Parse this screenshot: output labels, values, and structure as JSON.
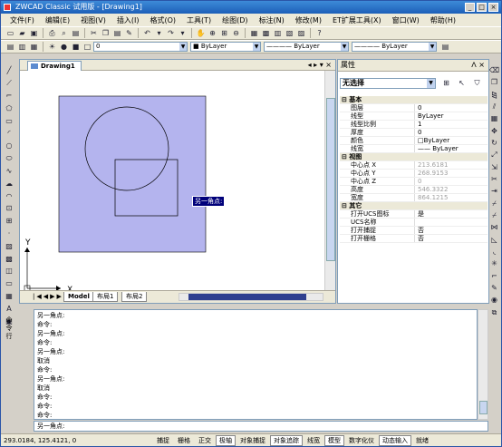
{
  "title": "ZWCAD Classic 试用版 - [Drawing1]",
  "window_buttons": [
    "_",
    "□",
    "×"
  ],
  "menu": [
    "文件(F)",
    "编辑(E)",
    "视图(V)",
    "插入(I)",
    "格式(O)",
    "工具(T)",
    "绘图(D)",
    "标注(N)",
    "修改(M)",
    "ET扩展工具(X)",
    "窗口(W)",
    "帮助(H)"
  ],
  "toolbar2": {
    "layer_value": "0",
    "color_value": "ByLayer",
    "linetype_value": "ByLayer",
    "lineweight_value": "ByLayer"
  },
  "document": {
    "tab": "Drawing1",
    "controls": "◂ ▸ ▾ ×",
    "layout_tabs": [
      "Model",
      "布局1",
      "布局2"
    ],
    "tooltip": "另一角点:"
  },
  "axes": {
    "x": "X",
    "y": "Y"
  },
  "properties": {
    "title": "属性",
    "controls": "ᐱ ×",
    "selection": "无选择",
    "rows": [
      {
        "cat": true,
        "k": "⊟ 基本"
      },
      {
        "k": "图层",
        "v": "0"
      },
      {
        "k": "线型",
        "v": "ByLayer"
      },
      {
        "k": "线型比例",
        "v": "1"
      },
      {
        "k": "厚度",
        "v": "0"
      },
      {
        "k": "颜色",
        "v": "□ByLayer"
      },
      {
        "k": "线宽",
        "v": "—— ByLayer"
      },
      {
        "cat": true,
        "k": "⊟ 视图"
      },
      {
        "k": "中心点 X",
        "v": "213.6181",
        "dim": true
      },
      {
        "k": "中心点 Y",
        "v": "268.9153",
        "dim": true
      },
      {
        "k": "中心点 Z",
        "v": "0",
        "dim": true
      },
      {
        "k": "高度",
        "v": "546.3322",
        "dim": true
      },
      {
        "k": "宽度",
        "v": "864.1215",
        "dim": true
      },
      {
        "cat": true,
        "k": "⊟ 其它"
      },
      {
        "k": "打开UCS图标",
        "v": "是"
      },
      {
        "k": "UCS名称",
        "v": ""
      },
      {
        "k": "打开捕捉",
        "v": "否"
      },
      {
        "k": "打开栅格",
        "v": "否"
      }
    ]
  },
  "command": {
    "label": "命令行",
    "lines": [
      "另一角点:",
      "命令:",
      "另一角点:",
      "命令:",
      "另一角点:",
      "取消",
      "命令:",
      "另一角点:",
      "取消",
      "命令:",
      "命令:",
      "命令:"
    ],
    "input": "另一角点:"
  },
  "status": {
    "coords": "293.0184, 125.4121, 0",
    "buttons": [
      {
        "label": "捕捉",
        "on": false
      },
      {
        "label": "栅格",
        "on": false
      },
      {
        "label": "正交",
        "on": false
      },
      {
        "label": "极轴",
        "on": true
      },
      {
        "label": "对象捕捉",
        "on": false
      },
      {
        "label": "对象追踪",
        "on": true
      },
      {
        "label": "线宽",
        "on": false
      },
      {
        "label": "模型",
        "on": true
      },
      {
        "label": "数字化仪",
        "on": false
      },
      {
        "label": "动态输入",
        "on": true
      },
      {
        "label": "就绪",
        "on": false
      }
    ]
  },
  "colors": {
    "selection_fill": "#b4b4ee",
    "accent": "#3d8bd8"
  }
}
